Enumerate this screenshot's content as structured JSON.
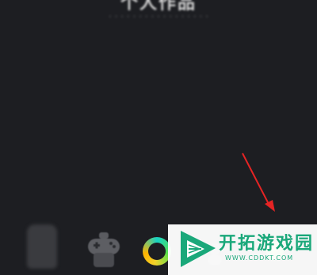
{
  "header": {
    "title": "个人作品",
    "subtitle": "· · · · · · · · · · · · · · · · ·"
  },
  "dock": {
    "items": [
      {
        "icon": "blurred-app-icon"
      },
      {
        "icon": "gamepad-icon"
      },
      {
        "icon": "ring-icon"
      },
      {
        "icon": "person-icon"
      },
      {
        "icon": "green-dot-icon"
      }
    ]
  },
  "annotation": {
    "color": "#e52424",
    "icon": "red-arrow-icon"
  },
  "watermark": {
    "logo": "cddkt-logo-icon",
    "name": "开拓游戏园",
    "url": "WWW.CDDKT.COM",
    "brand_color": "#1aa87a"
  }
}
